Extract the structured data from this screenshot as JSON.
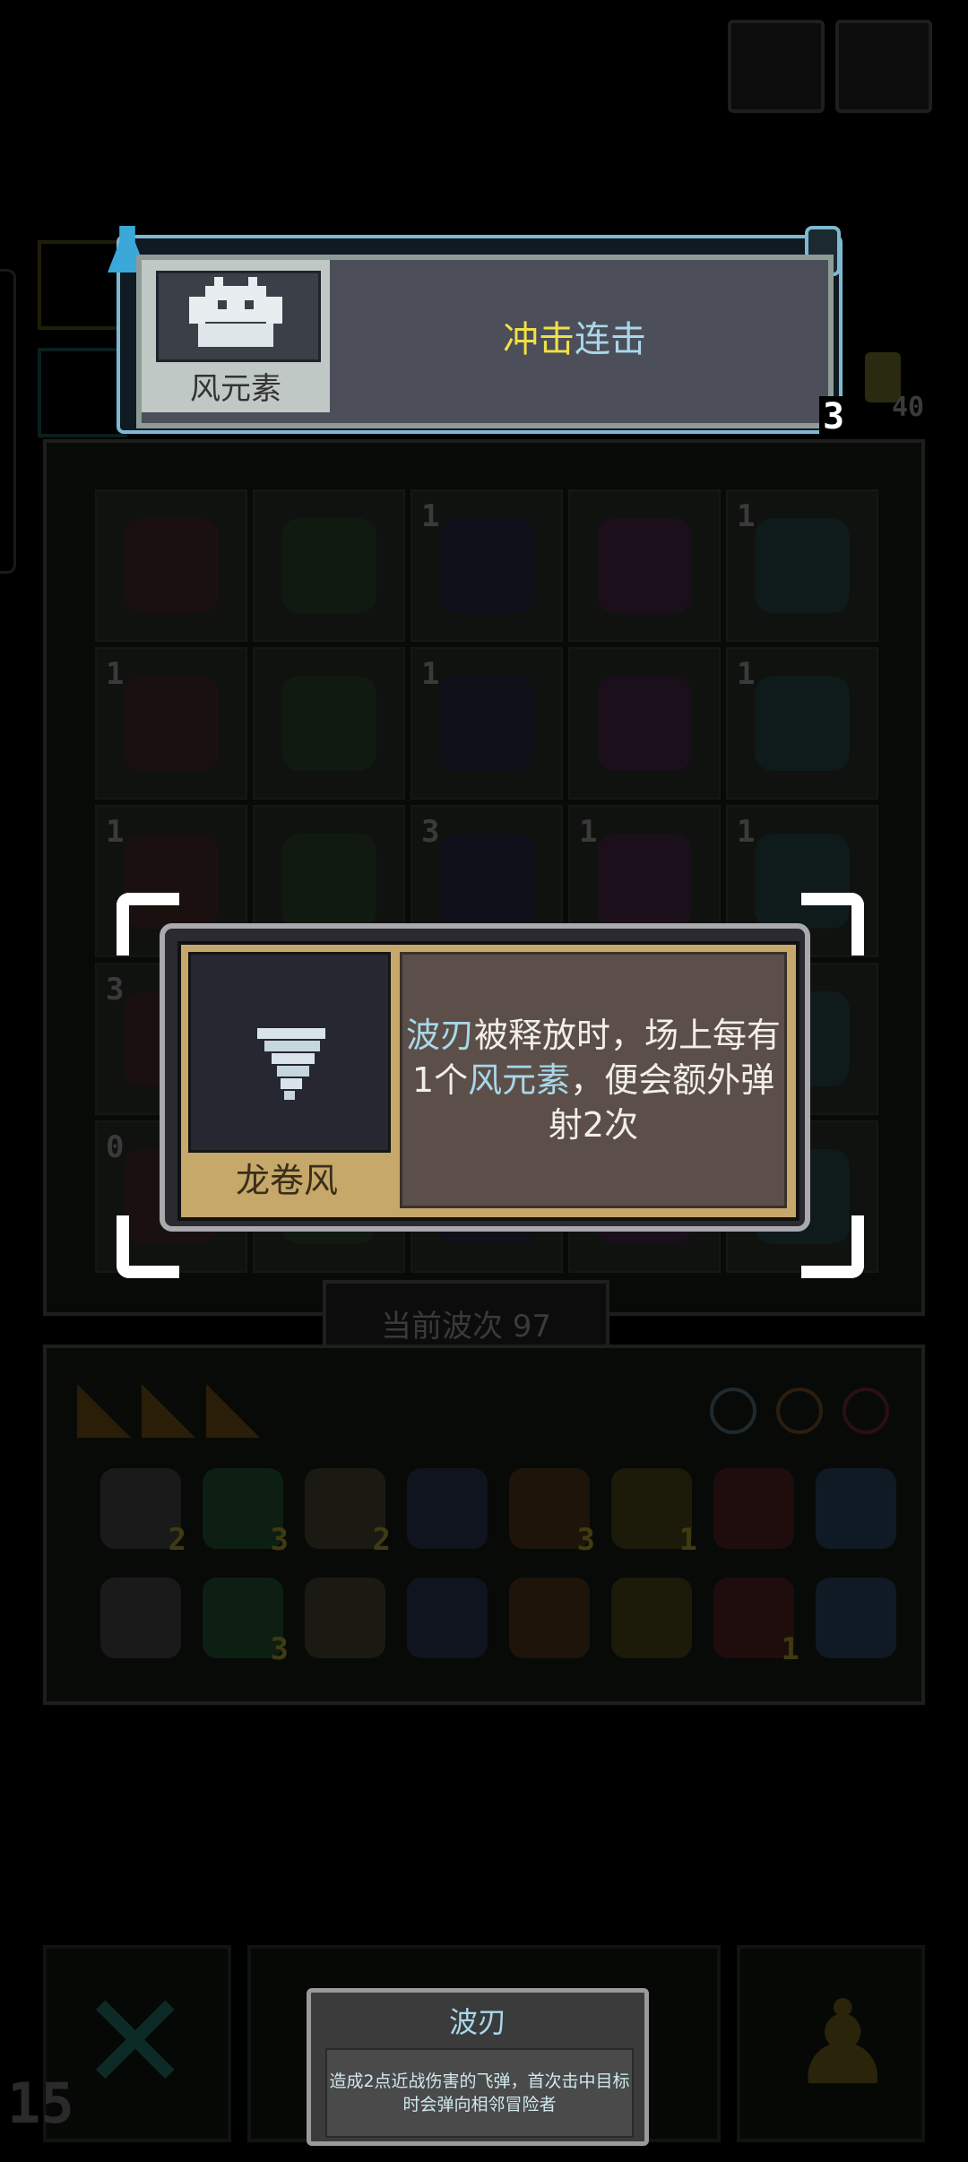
{
  "top_tooltip": {
    "unit_name": "风元素",
    "desc_part1": "冲击",
    "desc_part2": "连击",
    "stack_count": "3"
  },
  "side_counter": "40",
  "board": {
    "rows": [
      [
        {
          "level": ""
        },
        {
          "level": ""
        },
        {
          "level": "1"
        },
        {
          "level": ""
        },
        {
          "level": "1"
        }
      ],
      [
        {
          "level": "1"
        },
        {
          "level": ""
        },
        {
          "level": "1"
        },
        {
          "level": ""
        },
        {
          "level": "1"
        }
      ],
      [
        {
          "level": "1"
        },
        {
          "level": ""
        },
        {
          "level": "3"
        },
        {
          "level": "1"
        },
        {
          "level": "1"
        }
      ],
      [
        {
          "level": "3"
        },
        {
          "level": ""
        },
        {
          "level": ""
        },
        {
          "level": ""
        },
        {
          "level": ""
        }
      ],
      [
        {
          "level": "0"
        },
        {
          "level": ""
        },
        {
          "level": ""
        },
        {
          "level": ""
        },
        {
          "level": ""
        }
      ]
    ]
  },
  "card_tooltip": {
    "item_name": "龙卷风",
    "desc_kw1": "波刃",
    "desc_t1": "被释放时，场上每有1个",
    "desc_kw2": "风元素",
    "desc_t2": "，便会额外弹射2次"
  },
  "wave_label": "当前波次 97",
  "inventory": {
    "row1": [
      {
        "count": "2"
      },
      {
        "count": "3"
      },
      {
        "count": "2"
      },
      {
        "count": ""
      },
      {
        "count": "3"
      },
      {
        "count": "1"
      },
      {
        "count": ""
      },
      {
        "count": ""
      }
    ],
    "row2": [
      {
        "count": ""
      },
      {
        "count": "3"
      },
      {
        "count": ""
      },
      {
        "count": ""
      },
      {
        "count": ""
      },
      {
        "count": ""
      },
      {
        "count": "1"
      },
      {
        "count": ""
      }
    ]
  },
  "bottom_tooltip": {
    "title": "波刃",
    "body": "造成2点近战伤害的飞弹，首次击中目标时会弹向相邻冒险者"
  },
  "corner_number": "15",
  "colors": {
    "keyword_cyan": "#a8d8e8",
    "keyword_yellow": "#f0e04a",
    "card_gold": "#c5a86a"
  }
}
